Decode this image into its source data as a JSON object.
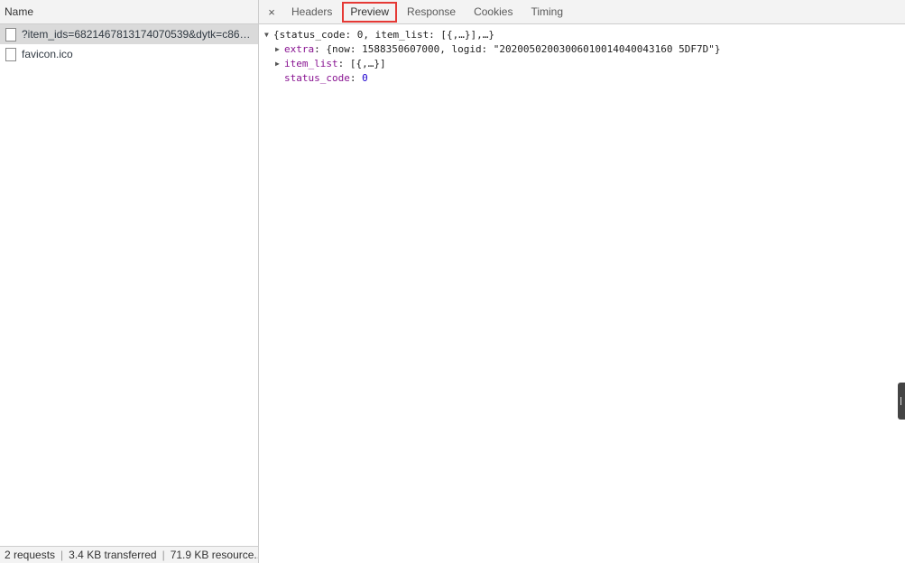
{
  "left": {
    "header": "Name",
    "requests": [
      {
        "name": "?item_ids=6821467813174070539&dytk=c864..."
      },
      {
        "name": "favicon.ico"
      }
    ],
    "footer": {
      "requests": "2 requests",
      "transferred": "3.4 KB transferred",
      "resources": "71.9 KB resource..."
    }
  },
  "tabs": {
    "close": "×",
    "items": [
      {
        "label": "Headers"
      },
      {
        "label": "Preview"
      },
      {
        "label": "Response"
      },
      {
        "label": "Cookies"
      },
      {
        "label": "Timing"
      }
    ],
    "active": "Preview"
  },
  "preview": {
    "root": "{status_code: 0, item_list: [{,…}],…}",
    "extra_key": "extra",
    "extra_value": "{now: 1588350607000, logid: \"20200502003006010014040043160 5DF7D\"}",
    "item_list_key": "item_list",
    "item_list_value": "[{,…}]",
    "status_code_key": "status_code",
    "status_code_value": "0"
  },
  "colors": {
    "active_tab_outline": "#e53935",
    "key": "#881391",
    "number": "#1c00cf"
  }
}
